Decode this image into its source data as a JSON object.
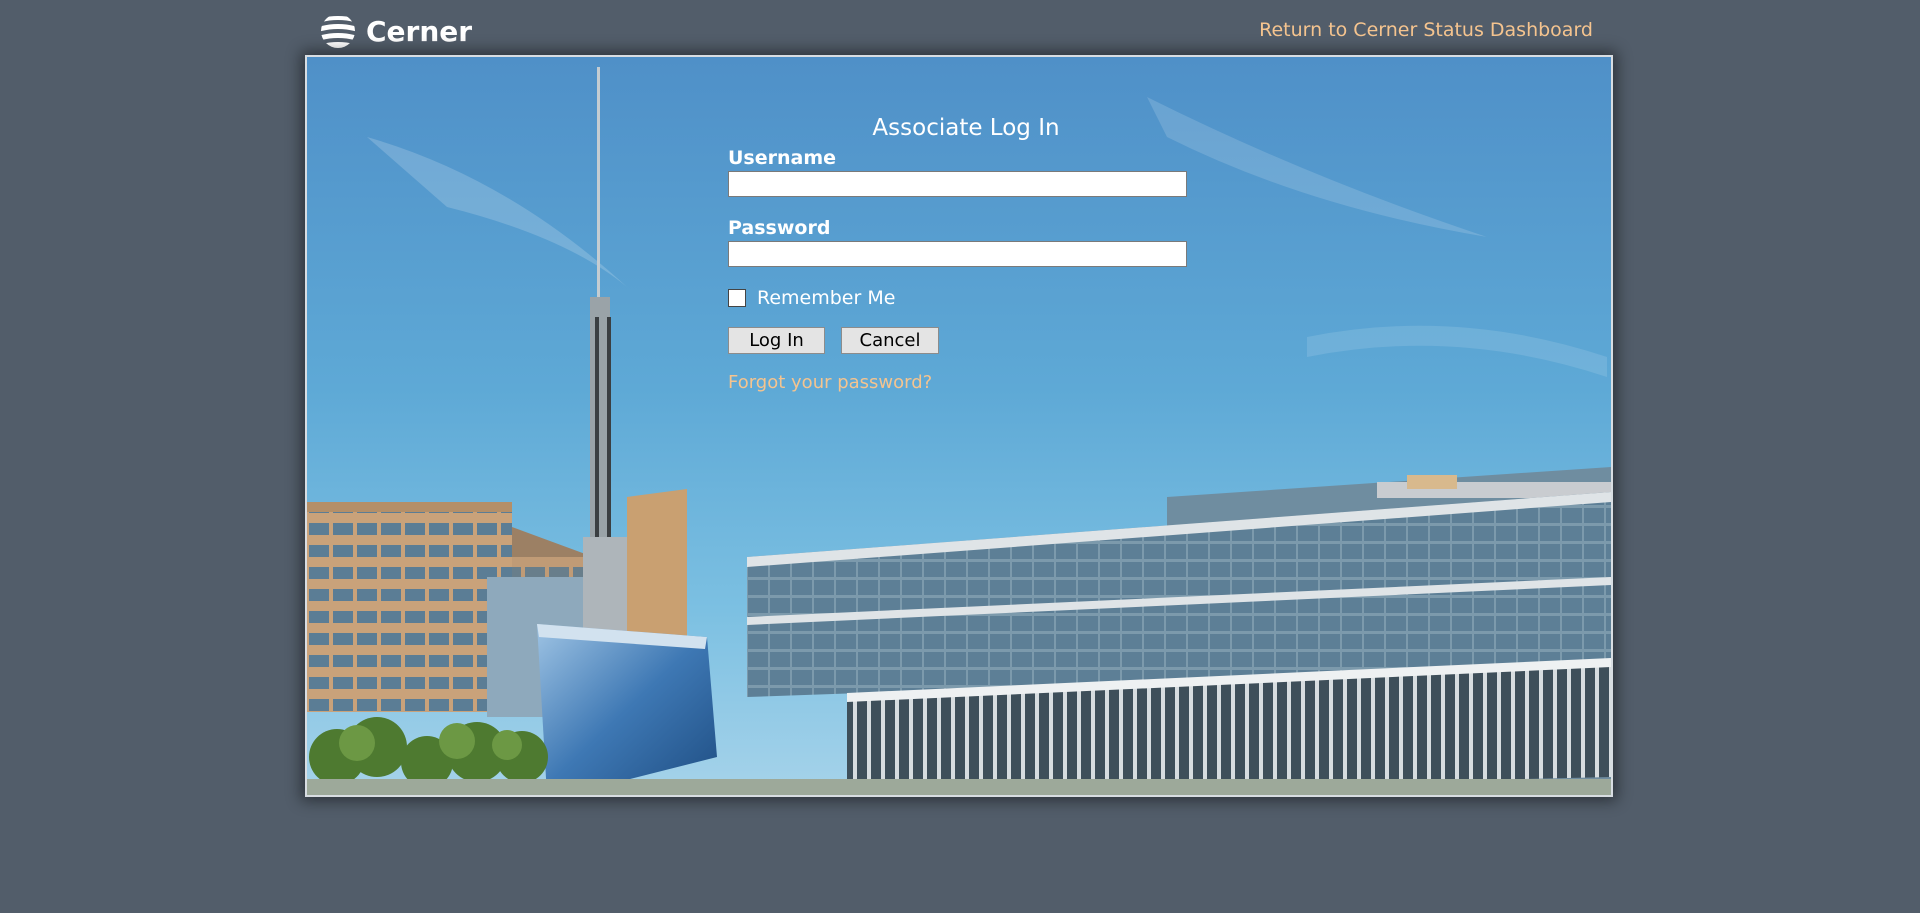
{
  "header": {
    "logo_text": "Cerner",
    "return_link": "Return to Cerner Status Dashboard"
  },
  "login": {
    "title": "Associate Log In",
    "username_label": "Username",
    "username_value": "",
    "password_label": "Password",
    "password_value": "",
    "remember_label": "Remember Me",
    "remember_checked": false,
    "login_button": "Log In",
    "cancel_button": "Cancel",
    "forgot_link": "Forgot your password?"
  },
  "colors": {
    "page_background": "#525d6a",
    "link_color": "#f5c48f",
    "sky": "#5ea9d6"
  },
  "icons": {
    "logo": "cerner-logo-icon"
  }
}
